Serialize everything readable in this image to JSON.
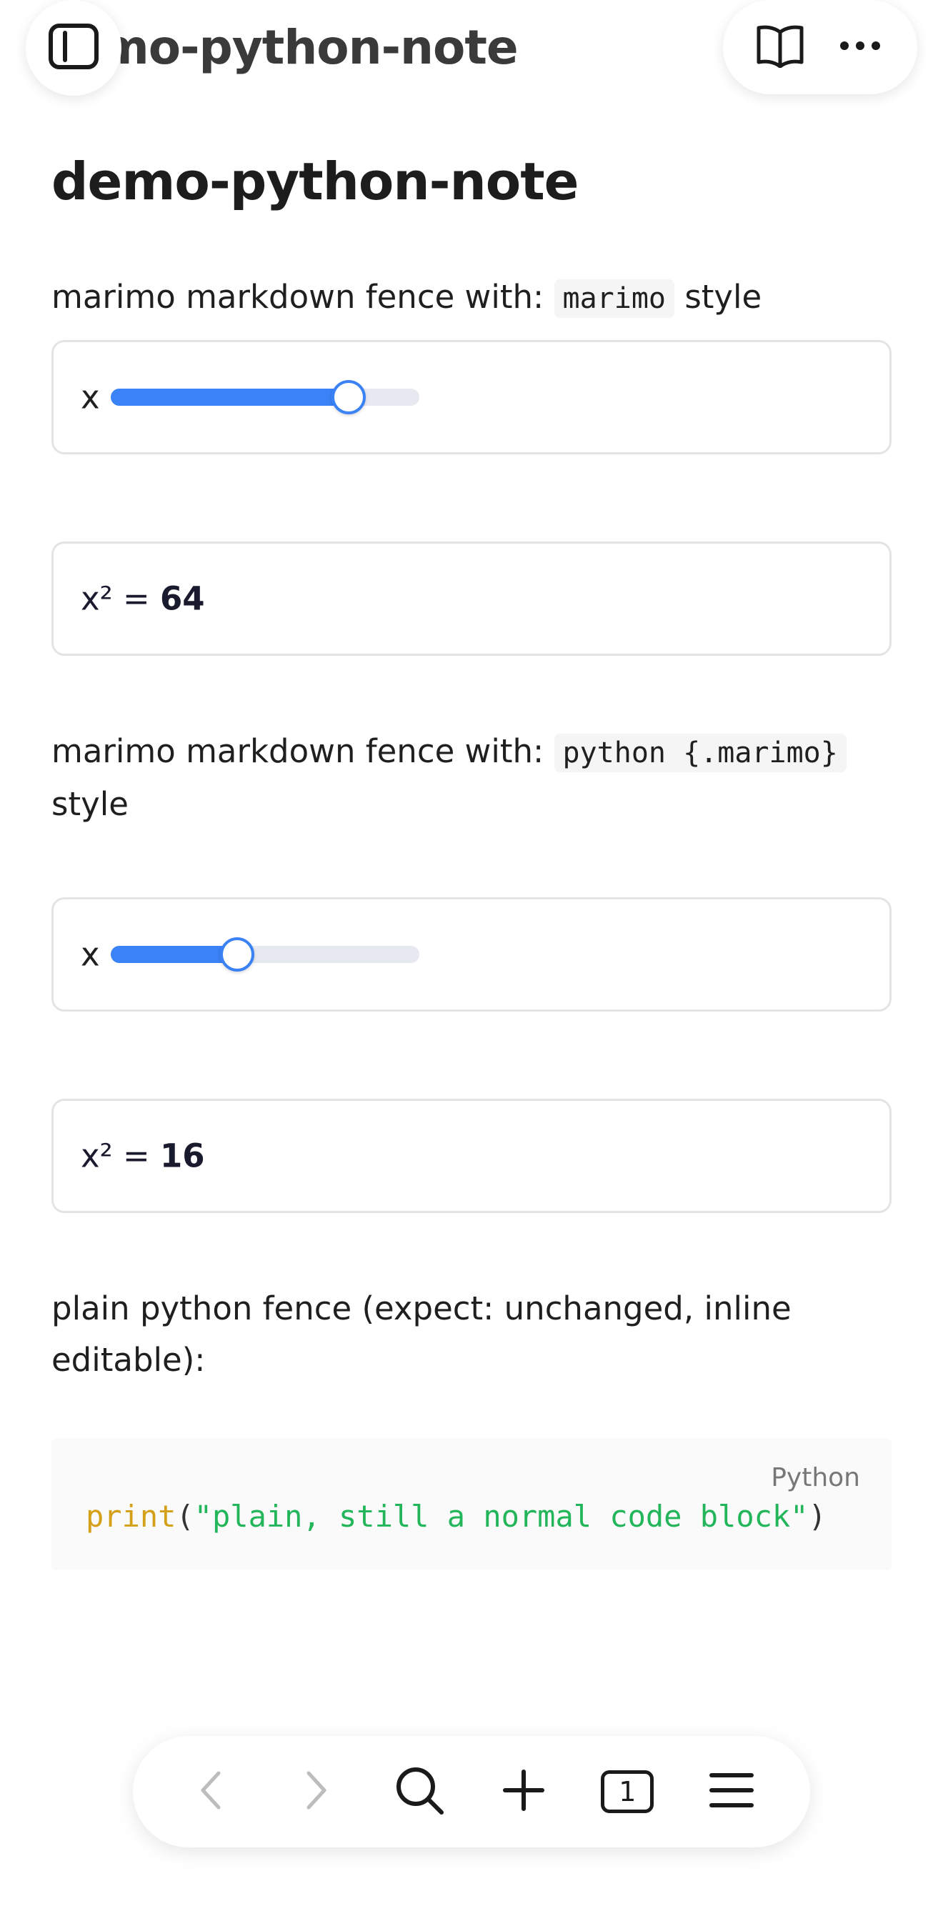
{
  "header": {
    "title_partial": "mo-python-note"
  },
  "doc": {
    "title": "demo-python-note",
    "para1": {
      "before": "marimo markdown fence with:",
      "code": "marimo",
      "after": "style"
    },
    "slider1": {
      "label": "x",
      "value_fraction": 0.77
    },
    "output1": {
      "prefix": "x² = ",
      "value": "64"
    },
    "para2": {
      "before": "marimo markdown fence with:",
      "code": "python {.marimo}",
      "after": "style"
    },
    "slider2": {
      "label": "x",
      "value_fraction": 0.41
    },
    "output2": {
      "prefix": "x² = ",
      "value": "16"
    },
    "para3": "plain python fence (expect: unchanged, inline editable):",
    "code_block": {
      "language": "Python",
      "fn": "print",
      "open": "(",
      "string": "\"plain, still a normal code block\"",
      "close": ")"
    }
  },
  "toolbar": {
    "tab_count": "1"
  },
  "colors": {
    "accent": "#3b82f6",
    "code_fn": "#d4a017",
    "code_string": "#22b55a"
  },
  "icons": [
    "sidebar-icon",
    "book-icon",
    "more-icon",
    "back-icon",
    "forward-icon",
    "search-icon",
    "plus-icon",
    "tabs-icon",
    "menu-icon"
  ]
}
